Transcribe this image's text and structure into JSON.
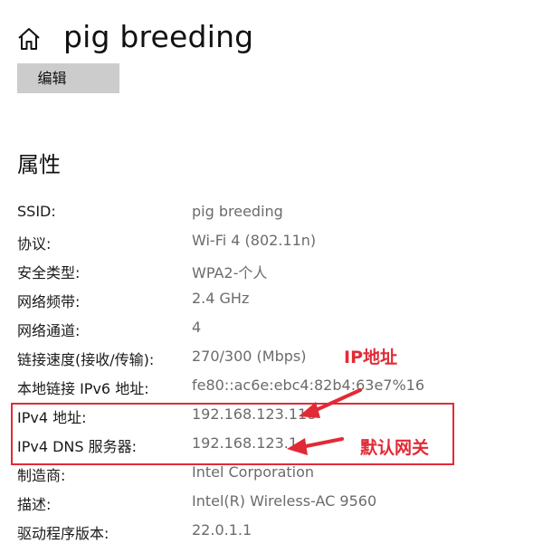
{
  "header": {
    "title": "pig breeding",
    "home_icon": "home-icon"
  },
  "edit_button": {
    "label": "编辑"
  },
  "section": {
    "title": "属性"
  },
  "properties": [
    {
      "key": "SSID:",
      "value": "pig breeding"
    },
    {
      "key": "协议:",
      "value": "Wi-Fi 4 (802.11n)"
    },
    {
      "key": "安全类型:",
      "value": "WPA2-个人"
    },
    {
      "key": "网络频带:",
      "value": "2.4 GHz"
    },
    {
      "key": "网络通道:",
      "value": "4"
    },
    {
      "key": "链接速度(接收/传输):",
      "value": "270/300 (Mbps)"
    },
    {
      "key": "本地链接 IPv6 地址:",
      "value": "fe80::ac6e:ebc4:82b4:63e7%16"
    },
    {
      "key": "IPv4 地址:",
      "value": "192.168.123.118"
    },
    {
      "key": "IPv4 DNS 服务器:",
      "value": "192.168.123.1"
    },
    {
      "key": "制造商:",
      "value": "Intel Corporation"
    },
    {
      "key": "描述:",
      "value": "Intel(R) Wireless-AC 9560"
    },
    {
      "key": "驱动程序版本:",
      "value": "22.0.1.1"
    }
  ],
  "annotations": {
    "ip_label": "IP地址",
    "gateway_label": "默认网关",
    "color": "#e22a36"
  }
}
